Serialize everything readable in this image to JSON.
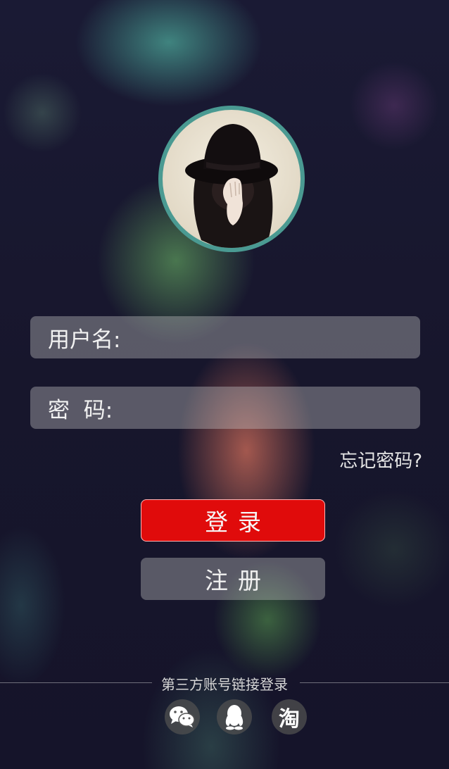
{
  "form": {
    "username_label": "用户名:",
    "password_label": "密  码:",
    "username_value": "",
    "password_value": ""
  },
  "links": {
    "forgot_password": "忘记密码?"
  },
  "buttons": {
    "login": "登录",
    "register": "注册"
  },
  "third_party": {
    "label": "第三方账号链接登录",
    "icons": [
      "wechat-icon",
      "qq-icon",
      "taobao-icon"
    ],
    "taobao_glyph": "淘"
  },
  "colors": {
    "accent": "#e00b0b",
    "avatar_ring": "#4a9a92"
  }
}
